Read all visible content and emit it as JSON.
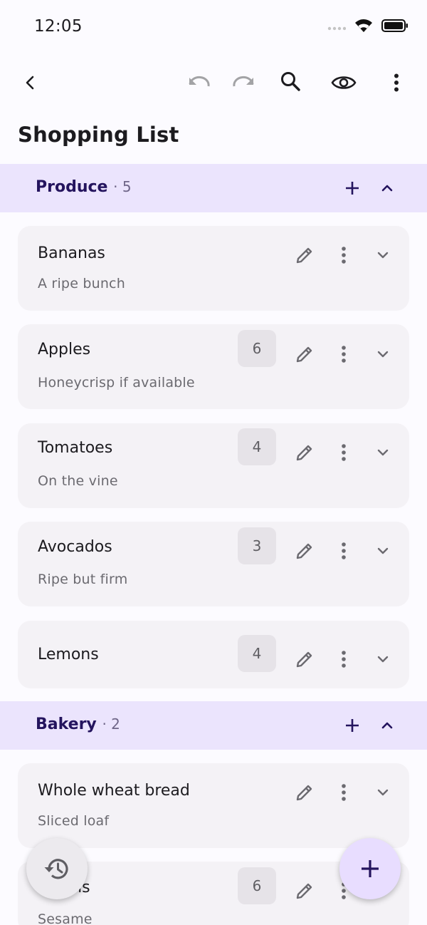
{
  "status_bar": {
    "time": "12:05"
  },
  "page": {
    "title": "Shopping List"
  },
  "sections": [
    {
      "name": "Produce",
      "count": "· 5",
      "items": [
        {
          "title": "Bananas",
          "note": "A ripe bunch",
          "qty": ""
        },
        {
          "title": "Apples",
          "note": "Honeycrisp if available",
          "qty": "6"
        },
        {
          "title": "Tomatoes",
          "note": "On the vine",
          "qty": "4"
        },
        {
          "title": "Avocados",
          "note": "Ripe but firm",
          "qty": "3"
        },
        {
          "title": "Lemons",
          "note": "",
          "qty": "4"
        }
      ]
    },
    {
      "name": "Bakery",
      "count": "· 2",
      "items": [
        {
          "title": "Whole wheat bread",
          "note": "Sliced loaf",
          "qty": ""
        },
        {
          "title": "Bagels",
          "note": "Sesame",
          "qty": "6"
        }
      ]
    }
  ],
  "colors": {
    "section_bg": "#ebe4fd",
    "card_bg": "#f4f2f6",
    "accent": "#24145e",
    "fab_primary": "#e8ddff"
  }
}
